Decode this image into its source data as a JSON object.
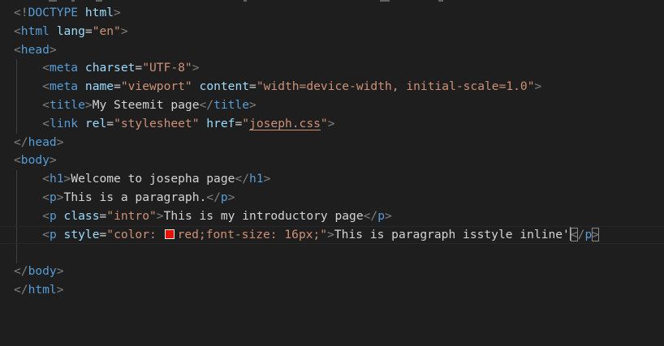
{
  "editor": {
    "swatch_color": "#e51400",
    "lines": [
      {
        "doctype_open": "<!",
        "doctype_kw": "DOCTYPE",
        "doctype_root": "html",
        "doctype_close": ">"
      },
      {
        "lt": "<",
        "tag": "html",
        "attr": "lang",
        "eq": "=",
        "val": "\"en\"",
        "gt": ">"
      },
      {
        "lt": "<",
        "tag": "head",
        "gt": ">"
      },
      {
        "lt": "<",
        "tag": "meta",
        "attr": "charset",
        "eq": "=",
        "val": "\"UTF-8\"",
        "gt": ">"
      },
      {
        "lt": "<",
        "tag": "meta",
        "attr1": "name",
        "eq1": "=",
        "val1": "\"viewport\"",
        "attr2": "content",
        "eq2": "=",
        "val2": "\"width=device-width, initial-scale=1.0\"",
        "gt": ">"
      },
      {
        "lt": "<",
        "tag": "title",
        "gt": ">",
        "text": "My Steemit page",
        "clt": "</",
        "ctag": "title",
        "cgt": ">"
      },
      {
        "lt": "<",
        "tag": "link",
        "attr1": "rel",
        "eq1": "=",
        "val1": "\"stylesheet\"",
        "attr2": "href",
        "eq2": "=",
        "q1": "\"",
        "href": "joseph.css",
        "q2": "\"",
        "gt": ">"
      },
      {
        "lt": "</",
        "tag": "head",
        "gt": ">"
      },
      {
        "lt": "<",
        "tag": "body",
        "gt": ">"
      },
      {
        "lt": "<",
        "tag": "h1",
        "gt": ">",
        "text": "Welcome to josepha page",
        "clt": "</",
        "ctag": "h1",
        "cgt": ">"
      },
      {
        "lt": "<",
        "tag": "p",
        "gt": ">",
        "text": "This is a paragraph.",
        "clt": "</",
        "ctag": "p",
        "cgt": ">"
      },
      {
        "lt": "<",
        "tag": "p",
        "attr": "class",
        "eq": "=",
        "val": "\"intro\"",
        "gt": ">",
        "text": "This is my introductory page",
        "clt": "</",
        "ctag": "p",
        "cgt": ">"
      },
      {
        "lt": "<",
        "tag": "p",
        "attr": "style",
        "eq": "=",
        "val_a": "\"color: ",
        "val_b": "red;font-size: 16px;\"",
        "gt": ">",
        "text": "This is paragraph isstyle inline'",
        "clt_a": "<",
        "clt_b": "/",
        "ctag": "p",
        "cgt": ">"
      },
      {},
      {
        "lt": "</",
        "tag": "body",
        "gt": ">"
      },
      {
        "lt": "</",
        "tag": "html",
        "gt": ">"
      }
    ]
  }
}
